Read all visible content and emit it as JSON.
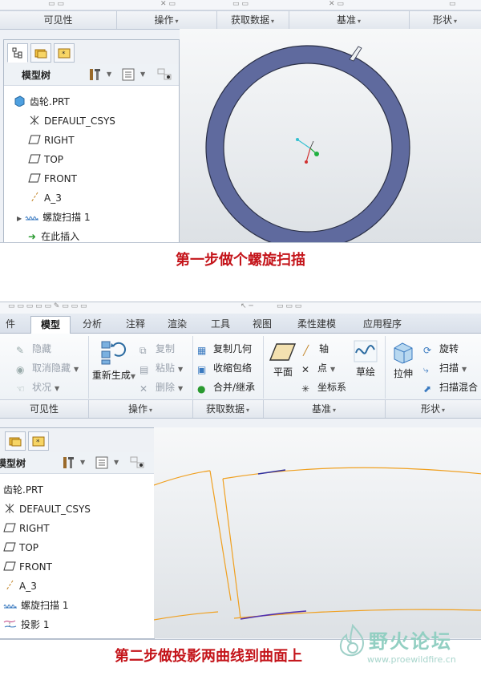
{
  "top": {
    "groups": [
      {
        "label": "可见性",
        "arrow": false
      },
      {
        "label": "操作",
        "arrow": true
      },
      {
        "label": "获取数据",
        "arrow": true
      },
      {
        "label": "基准",
        "arrow": true
      },
      {
        "label": "形状",
        "arrow": true
      }
    ],
    "tree_title": "模型树",
    "tree_items": [
      {
        "label": "齿轮.PRT",
        "icon": "part-icon"
      },
      {
        "label": "DEFAULT_CSYS",
        "icon": "csys-icon"
      },
      {
        "label": "RIGHT",
        "icon": "datum-plane-icon"
      },
      {
        "label": "TOP",
        "icon": "datum-plane-icon"
      },
      {
        "label": "FRONT",
        "icon": "datum-plane-icon"
      },
      {
        "label": "A_3",
        "icon": "axis-icon"
      },
      {
        "label": "螺旋扫描 1",
        "icon": "helical-sweep-icon"
      },
      {
        "label": "在此插入",
        "icon": "insert-arrow-icon"
      }
    ],
    "ring_color": "#5f6a9e"
  },
  "caption1": "第一步做个螺旋扫描",
  "bottom": {
    "tabs": [
      "件",
      "模型",
      "分析",
      "注释",
      "渲染",
      "工具",
      "视图",
      "柔性建模",
      "应用程序"
    ],
    "active_tab": "模型",
    "ribbon": {
      "hide": "隐藏",
      "unhide": "取消隐藏",
      "status": "状况",
      "regenerate": "重新生成",
      "copy": "复制",
      "paste": "粘贴",
      "delete": "删除",
      "copy_geom": "复制几何",
      "shrinkwrap": "收缩包络",
      "merge_inherit": "合并/继承",
      "plane": "平面",
      "axis": "轴",
      "point": "点",
      "csys": "坐标系",
      "sketch": "草绘",
      "extrude": "拉伸",
      "revolve": "旋转",
      "sweep": "扫描",
      "swept_blend": "扫描混合"
    },
    "groups": [
      {
        "label": "可见性",
        "arrow": false
      },
      {
        "label": "操作",
        "arrow": true
      },
      {
        "label": "获取数据",
        "arrow": true
      },
      {
        "label": "基准",
        "arrow": true
      },
      {
        "label": "形状",
        "arrow": true
      }
    ],
    "tree_title": "模型树",
    "tree_items": [
      {
        "label": "齿轮.PRT",
        "icon": "part-icon"
      },
      {
        "label": "DEFAULT_CSYS",
        "icon": "csys-icon"
      },
      {
        "label": "RIGHT",
        "icon": "datum-plane-icon"
      },
      {
        "label": "TOP",
        "icon": "datum-plane-icon"
      },
      {
        "label": "FRONT",
        "icon": "datum-plane-icon"
      },
      {
        "label": "A_3",
        "icon": "axis-icon"
      },
      {
        "label": "螺旋扫描 1",
        "icon": "helical-sweep-icon"
      },
      {
        "label": "投影 1",
        "icon": "projection-icon"
      }
    ],
    "curve_color": "#f0a020"
  },
  "caption2": "第二步做投影两曲线到曲面上",
  "watermark": {
    "title": "野火论坛",
    "url": "www.proewildfire.cn"
  }
}
